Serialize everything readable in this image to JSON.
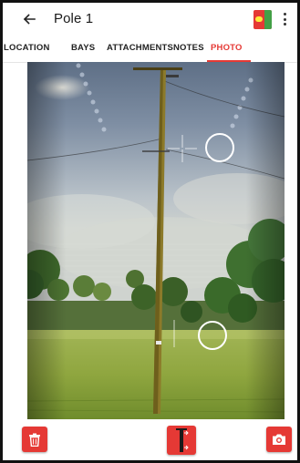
{
  "app_bar": {
    "title": "Pole 1",
    "icons": [
      "back-arrow-icon",
      "app-badge-icon",
      "more-vert-icon"
    ]
  },
  "tabs": {
    "items": [
      {
        "label": "LOCATION"
      },
      {
        "label": "BAYS"
      },
      {
        "label": "ATTACHMENTS"
      },
      {
        "label": "NOTES"
      },
      {
        "label": "PHOTO"
      }
    ],
    "active": "PHOTO"
  },
  "photo": {
    "subject": "utility pole in a field",
    "markers": [
      "crosshair-marker",
      "circle-marker",
      "circle-marker"
    ]
  },
  "bottom_bar": {
    "icons": [
      "trash-icon",
      "measure-pole-icon",
      "camera-icon"
    ]
  },
  "colors": {
    "accent": "#e53935",
    "badge_green": "#43a047",
    "text": "#222222"
  }
}
